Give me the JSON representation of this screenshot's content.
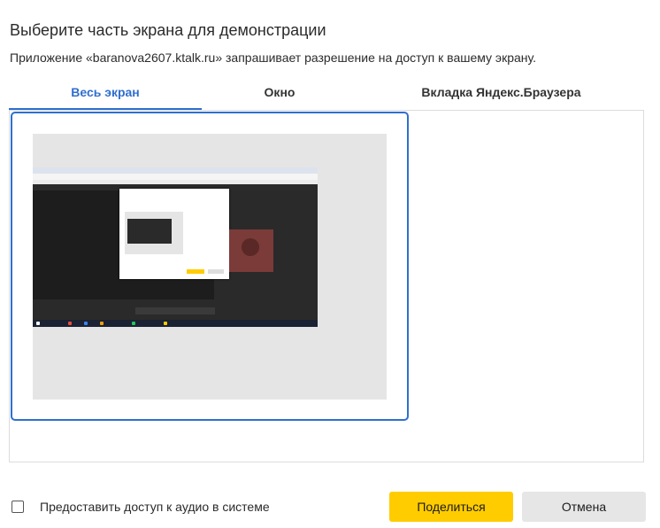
{
  "dialog": {
    "title": "Выберите часть экрана для демонстрации",
    "subtitle": "Приложение «baranova2607.ktalk.ru» запрашивает разрешение на доступ к вашему экрану."
  },
  "tabs": [
    {
      "label": "Весь экран",
      "active": true
    },
    {
      "label": "Окно",
      "active": false
    },
    {
      "label": "Вкладка Яндекс.Браузера",
      "active": false
    }
  ],
  "sources": [
    {
      "kind": "screen-thumbnail",
      "selected": true
    }
  ],
  "audio": {
    "label": "Предоставить доступ к аудио в системе",
    "checked": false
  },
  "buttons": {
    "share": "Поделиться",
    "cancel": "Отмена"
  },
  "colors": {
    "accent": "#2f6fce",
    "share_bg": "#ffcc00",
    "cancel_bg": "#e6e6e6"
  }
}
